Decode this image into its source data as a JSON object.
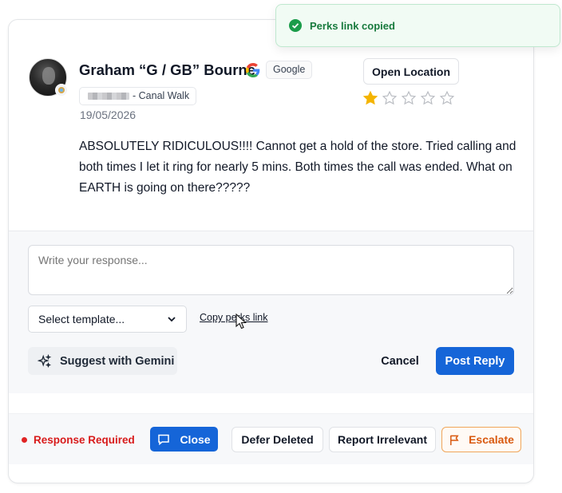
{
  "toast": {
    "message": "Perks link copied",
    "icon": "check-circle-icon",
    "color": "#1a9c4a"
  },
  "review": {
    "reviewer_name": "Graham “G / GB” Bourne",
    "source": "Google",
    "location_suffix": "- Canal Walk",
    "date": "19/05/2026",
    "open_location_label": "Open Location",
    "rating": 1,
    "max_rating": 5,
    "text": "ABSOLUTELY RIDICULOUS!!!! Cannot get a hold of the store. Tried calling and both times I let it ring for nearly 5 mins. Both times the call was ended. What on EARTH is going on there?????"
  },
  "reply": {
    "placeholder": "Write your response...",
    "template_select": {
      "selected": "Select template...",
      "options": [
        "Select template..."
      ]
    },
    "copy_perks_label": "Copy perks link",
    "gemini_label": "Suggest with Gemini",
    "cancel_label": "Cancel",
    "post_label": "Post Reply"
  },
  "actions": {
    "status_label": "Response Required",
    "close_label": "Close",
    "defer_label": "Defer Deleted",
    "irrelevant_label": "Report Irrelevant",
    "escalate_label": "Escalate"
  },
  "colors": {
    "primary": "#1565d8",
    "star": "#f4b400",
    "status": "#d81b1b",
    "escalate": "#d9590f",
    "toast_text": "#177a3d"
  }
}
